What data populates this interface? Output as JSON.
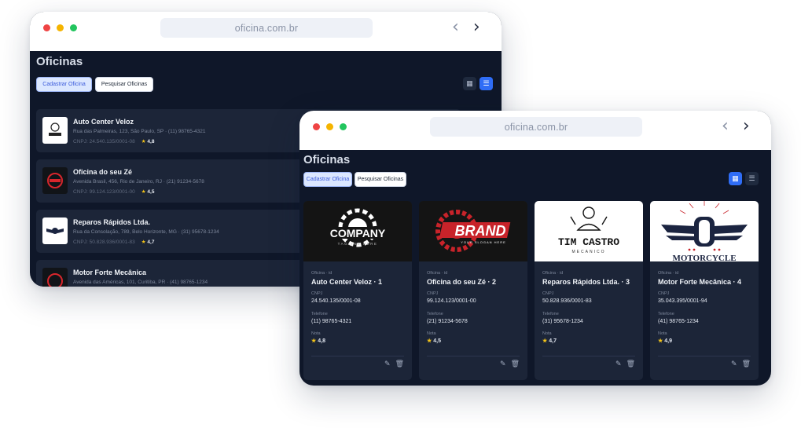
{
  "back_window": {
    "url": "oficina.com.br",
    "page_title": "Oficinas",
    "buttons": {
      "register": "Cadastrar Oficina",
      "search": "Pesquisar Oficinas"
    },
    "items": [
      {
        "name": "Auto Center Veloz",
        "address": "Rua das Palmeiras, 123, São Paulo, SP · (11) 98765-4321",
        "cnpj": "CNPJ: 24.540.135/0001-08",
        "rating": "4,8",
        "thumb": "TIM CASTRO"
      },
      {
        "name": "Oficina do seu Zé",
        "address": "Avenida Brasil, 456, Rio de Janeiro, RJ · (21) 91234-5678",
        "cnpj": "CNPJ: 99.124.123/0001-00",
        "rating": "4,5",
        "thumb": "BRAND"
      },
      {
        "name": "Reparos Rápidos Ltda.",
        "address": "Rua da Consolação, 789, Belo Horizonte, MG · (31) 95678-1234",
        "cnpj": "CNPJ: 50.828.936/0001-83",
        "rating": "4,7",
        "thumb": "MOTORCYCLE"
      },
      {
        "name": "Motor Forte Mecânica",
        "address": "Avenida das Américas, 101, Curitiba, PR · (41) 98765-1234",
        "cnpj": "",
        "rating": "",
        "thumb": "BRAND"
      }
    ]
  },
  "front_window": {
    "url": "oficina.com.br",
    "page_title": "Oficinas",
    "buttons": {
      "register": "Cadastrar Oficina",
      "search": "Pesquisar Oficinas"
    },
    "labels": {
      "cnpj": "CNPJ",
      "phone": "Telefone",
      "rating": "Nota"
    },
    "cards": [
      {
        "kicker": "Oficina · id",
        "title": "Auto Center Veloz · 1",
        "cnpj": "24.540.135/0001-08",
        "phone": "(11) 98765-4321",
        "rating": "4,8",
        "logo": "COMPANY",
        "logo_sub": "TAGLINE HERE"
      },
      {
        "kicker": "Oficina · id",
        "title": "Oficina do seu Zé · 2",
        "cnpj": "99.124.123/0001-00",
        "phone": "(21) 91234-5678",
        "rating": "4,5",
        "logo": "BRAND",
        "logo_sub": "YOUR SLOGAN HERE"
      },
      {
        "kicker": "Oficina · id",
        "title": "Reparos Rápidos Ltda. · 3",
        "cnpj": "50.828.936/0001-83",
        "phone": "(31) 95678-1234",
        "rating": "4,7",
        "logo": "TIM CASTRO",
        "logo_sub": "MECANICO"
      },
      {
        "kicker": "Oficina · id",
        "title": "Motor Forte Mecânica · 4",
        "cnpj": "35.043.395/0001-94",
        "phone": "(41) 98765-1234",
        "rating": "4,9",
        "logo": "MOTORCYCLE",
        "logo_sub": ""
      }
    ]
  },
  "icons": {
    "star": "star-icon",
    "edit": "pencil-icon",
    "delete": "trash-icon",
    "grid": "grid-icon",
    "list": "list-icon"
  }
}
